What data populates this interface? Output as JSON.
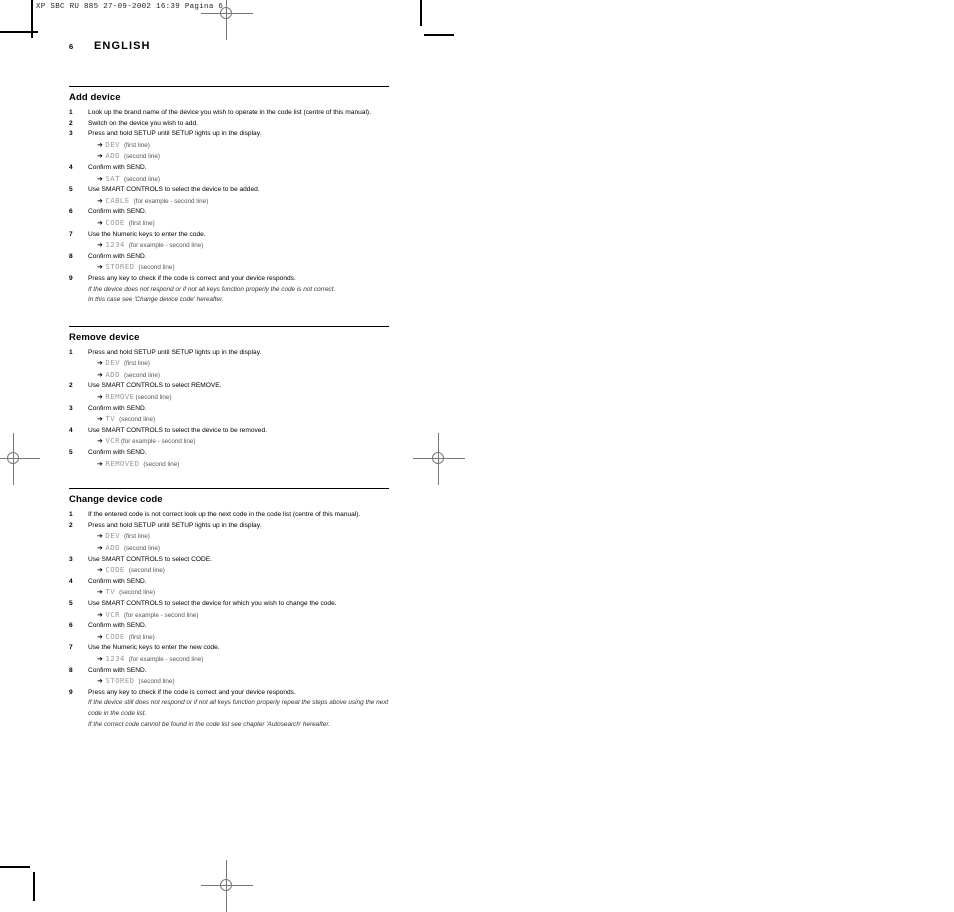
{
  "prepress": {
    "slug": "XP SBC RU 885   27-09-2002 16:39  Pagina 6"
  },
  "running_head": {
    "folio": "6",
    "chapter": "ENGLISH"
  },
  "sections": [
    {
      "heading": "Add device",
      "blocks": [
        {
          "kind": "step",
          "num": "1",
          "text": "Look up the brand name of the device you wish to operate in the code list (centre of this manual)."
        },
        {
          "kind": "step",
          "num": "2",
          "text": "Switch on the device you wish to add."
        },
        {
          "kind": "step",
          "num": "3",
          "text": "Press and hold SETUP until SETUP lights up in the display."
        },
        {
          "kind": "readout",
          "arrow": "right-arrow-icon",
          "lcd": "DEV",
          "note": "(first line)"
        },
        {
          "kind": "readout",
          "arrow": "right-arrow-icon",
          "lcd": "ADD",
          "note": "(second line)"
        },
        {
          "kind": "step",
          "num": "4",
          "text": "Confirm with SEND."
        },
        {
          "kind": "readout",
          "arrow": "right-arrow-icon",
          "lcd": "SAT",
          "note": "(second line)"
        },
        {
          "kind": "step",
          "num": "5",
          "text": "Use SMART CONTROLS to select the device to be added."
        },
        {
          "kind": "readout",
          "arrow": "right-arrow-icon",
          "lcd": "CABLE",
          "note": "(for example - second line)"
        },
        {
          "kind": "step",
          "num": "6",
          "text": "Confirm with SEND."
        },
        {
          "kind": "readout",
          "arrow": "right-arrow-icon",
          "lcd": "CODE",
          "note": "(first line)"
        },
        {
          "kind": "step",
          "num": "7",
          "text": "Use the Numeric keys to enter the code."
        },
        {
          "kind": "readout",
          "arrow": "right-arrow-icon",
          "lcd": "1234",
          "note": "(for example - second line)"
        },
        {
          "kind": "step",
          "num": "8",
          "text": "Confirm with SEND."
        },
        {
          "kind": "readout",
          "arrow": "right-arrow-icon",
          "lcd": "STORED",
          "note": "(second line)"
        },
        {
          "kind": "step",
          "num": "9",
          "text": "Press any key to check if the code is correct and your device responds."
        },
        {
          "kind": "remark",
          "text": "If the device does not respond or if not all keys function properly the code is not correct."
        },
        {
          "kind": "remark",
          "text": "In this case see 'Change device code' hereafter."
        }
      ]
    },
    {
      "heading": "Remove device",
      "blocks": [
        {
          "kind": "step",
          "num": "1",
          "text": "Press and hold SETUP until SETUP lights up in the display."
        },
        {
          "kind": "readout",
          "arrow": "right-arrow-icon",
          "lcd": "DEV",
          "note": "(first line)"
        },
        {
          "kind": "readout",
          "arrow": "right-arrow-icon",
          "lcd": "ADD",
          "note": "(second line)"
        },
        {
          "kind": "step",
          "num": "2",
          "text": "Use SMART CONTROLS to select REMOVE."
        },
        {
          "kind": "readout",
          "arrow": "right-arrow-icon",
          "lcd": "REMOVE",
          "note": "(second line)",
          "tight": true
        },
        {
          "kind": "step",
          "num": "3",
          "text": "Confirm with SEND."
        },
        {
          "kind": "readout",
          "arrow": "right-arrow-icon",
          "lcd": "TV",
          "note": "(second line)"
        },
        {
          "kind": "step",
          "num": "4",
          "text": "Use SMART CONTROLS to select the device to be removed."
        },
        {
          "kind": "readout",
          "arrow": "right-arrow-icon",
          "lcd": "VCR",
          "note": "(for example - second line)",
          "tight": true
        },
        {
          "kind": "step",
          "num": "5",
          "text": "Confirm with SEND."
        },
        {
          "kind": "readout",
          "arrow": "right-arrow-icon",
          "lcd": "REMOVED",
          "note": "(second line)"
        }
      ]
    },
    {
      "heading": "Change device code",
      "blocks": [
        {
          "kind": "step",
          "num": "1",
          "text": "If the entered code is not correct look up the next code in the code list (centre of this manual)."
        },
        {
          "kind": "step",
          "num": "2",
          "text": "Press and hold SETUP until SETUP lights up in the display."
        },
        {
          "kind": "readout",
          "arrow": "right-arrow-icon",
          "lcd": "DEV",
          "note": "(first line)"
        },
        {
          "kind": "readout",
          "arrow": "right-arrow-icon",
          "lcd": "ADD",
          "note": "(second line)"
        },
        {
          "kind": "step",
          "num": "3",
          "text": "Use SMART CONTROLS to select CODE."
        },
        {
          "kind": "readout",
          "arrow": "right-arrow-icon",
          "lcd": "CODE",
          "note": "(second line)"
        },
        {
          "kind": "step",
          "num": "4",
          "text": "Confirm with SEND."
        },
        {
          "kind": "readout",
          "arrow": "right-arrow-icon",
          "lcd": "TV",
          "note": "(second line)"
        },
        {
          "kind": "step",
          "num": "5",
          "text": "Use SMART CONTROLS to select the device for which you wish to change the code."
        },
        {
          "kind": "readout",
          "arrow": "right-arrow-icon",
          "lcd": "VCR",
          "note": "(for example - second line)"
        },
        {
          "kind": "step",
          "num": "6",
          "text": "Confirm with SEND."
        },
        {
          "kind": "readout",
          "arrow": "right-arrow-icon",
          "lcd": "CODE",
          "note": "(first line)"
        },
        {
          "kind": "step",
          "num": "7",
          "text": "Use the Numeric keys to enter the new code."
        },
        {
          "kind": "readout",
          "arrow": "right-arrow-icon",
          "lcd": "1234",
          "note": "(for example - second line)"
        },
        {
          "kind": "step",
          "num": "8",
          "text": "Confirm with SEND."
        },
        {
          "kind": "readout",
          "arrow": "right-arrow-icon",
          "lcd": "STORED",
          "note": "(second line)"
        },
        {
          "kind": "step",
          "num": "9",
          "text": "Press any key to check if the code is correct and your device responds."
        },
        {
          "kind": "remark",
          "text": "If the device still does not respond or if not all keys function properly repeat the steps above using the next code in the code list."
        },
        {
          "kind": "remark",
          "text": "If the correct code cannot be found in the code list see chapter 'Autosearch' hereafter."
        }
      ]
    }
  ]
}
